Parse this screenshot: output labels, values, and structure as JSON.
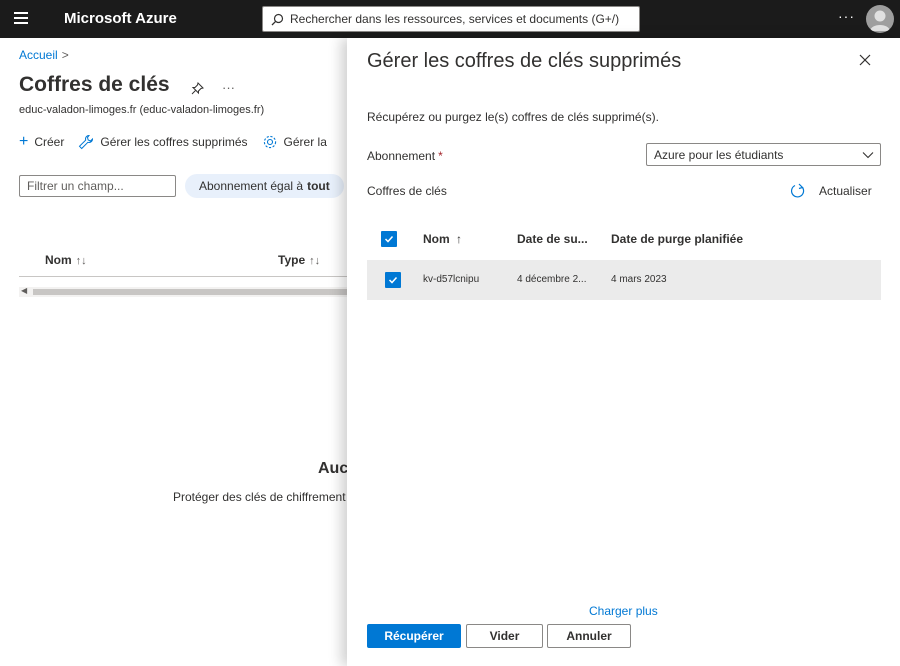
{
  "topbar": {
    "brand": "Microsoft Azure",
    "search_placeholder": "Rechercher dans les ressources, services et documents (G+/)",
    "more": "···"
  },
  "page": {
    "breadcrumb": "Accueil",
    "breadcrumb_sep": ">",
    "title": "Coffres de clés",
    "more": "···",
    "subtitle": "educ-valadon-limoges.fr (educ-valadon-limoges.fr)",
    "toolbar": {
      "create": "Créer",
      "manage_deleted": "Gérer les coffres supprimés",
      "manage_view": "Gérer la"
    },
    "filter_placeholder": "Filtrer un champ...",
    "filter_pill_prefix": "Abonnement égal à",
    "filter_pill_value": "tout",
    "columns": {
      "name": "Nom",
      "type": "Type",
      "sort_icon": "↑↓"
    },
    "empty_title": "Auc",
    "empty_desc": "Protéger des clés de chiffrement"
  },
  "panel": {
    "title": "Gérer les coffres de clés supprimés",
    "description": "Récupérez ou purgez le(s) coffres de clés supprimé(s).",
    "subscription_label": "Abonnement",
    "required_mark": "*",
    "subscription_value": "Azure pour les étudiants",
    "vaults_label": "Coffres de clés",
    "refresh": "Actualiser",
    "grid": {
      "headers": {
        "name": "Nom",
        "name_sort": "↑",
        "deleted_date": "Date de su...",
        "purge_date": "Date de purge planifiée"
      },
      "rows": [
        {
          "name": "kv-d57lcnipu",
          "deleted_date": "4 décembre 2...",
          "purge_date": "4 mars 2023",
          "selected": true
        }
      ]
    },
    "load_more": "Charger plus",
    "buttons": {
      "recover": "Récupérer",
      "purge": "Vider",
      "cancel": "Annuler"
    }
  },
  "colors": {
    "accent": "#0078d4",
    "topbar": "#1b1b1b",
    "pill": "#e8f0fb",
    "row_selected": "#ebebeb"
  }
}
